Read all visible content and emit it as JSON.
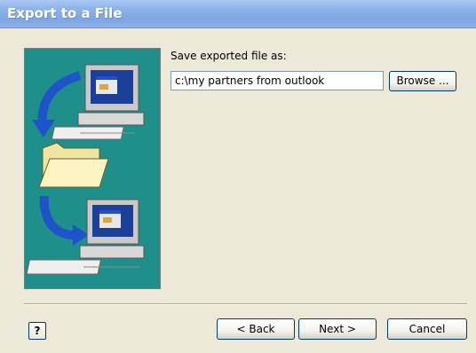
{
  "window": {
    "title": "Export to a File"
  },
  "form": {
    "label": "Save exported file as:",
    "path_value": "c:\\my partners from outlook",
    "browse_label": "Browse ..."
  },
  "buttons": {
    "help_icon": "?",
    "back_label": "< Back",
    "next_label": "Next >",
    "cancel_label": "Cancel"
  },
  "colors": {
    "art_background": "#1e8f8a",
    "title_text": "#ffffff"
  }
}
